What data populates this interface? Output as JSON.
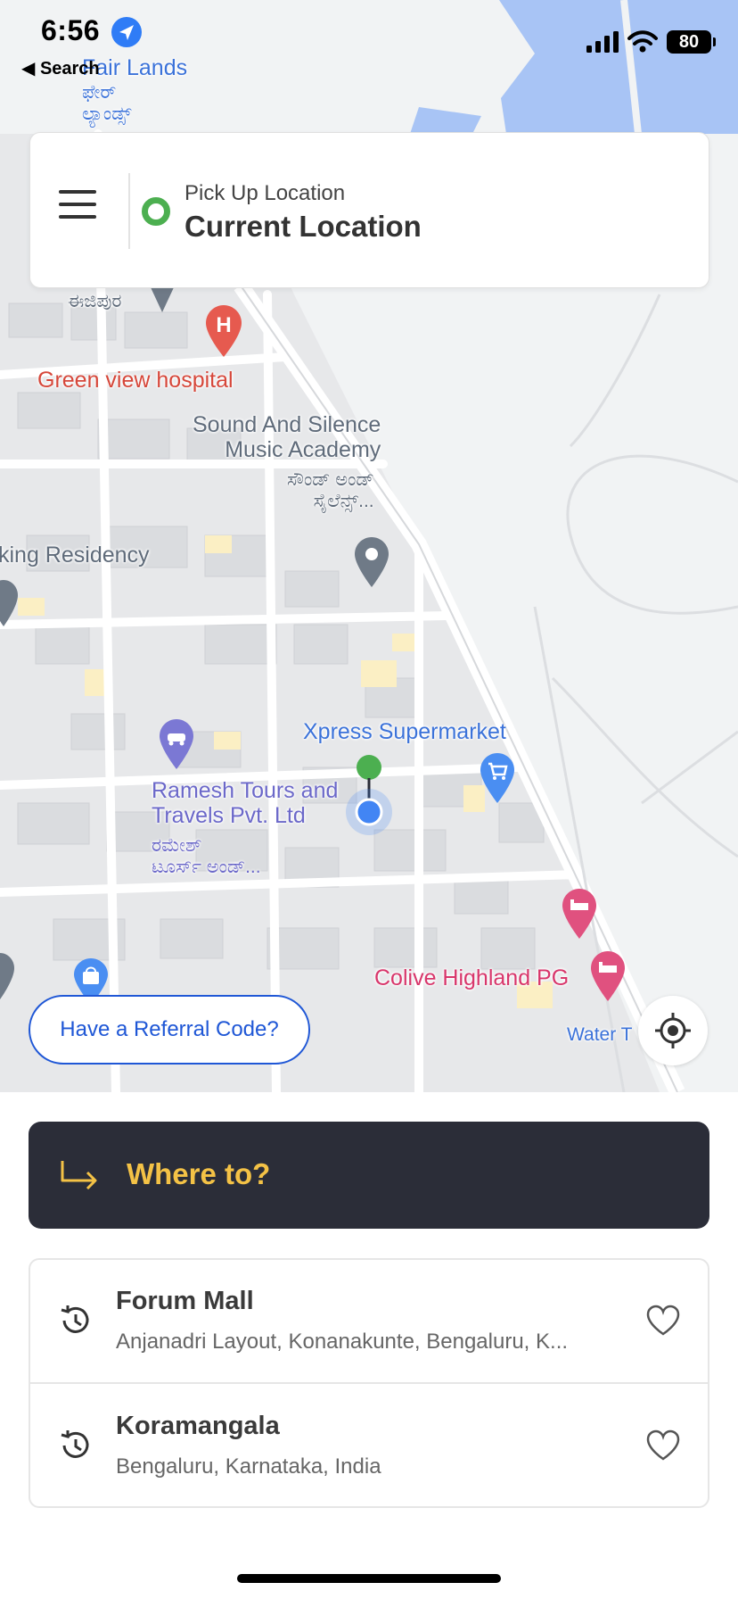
{
  "status_bar": {
    "time": "6:56",
    "back_label": "◀ Search",
    "battery": "80",
    "icons": [
      "location-arrow-icon",
      "signal-icon",
      "wifi-icon",
      "battery-icon"
    ]
  },
  "map": {
    "labels": {
      "fair_lands": "Fair Lands",
      "fair_lands_kn": "ಫೇರ್\nಲ್ಯಾಂಡ್ಸ್",
      "ejipura": "ಈಜಿಪುರ",
      "hospital": "Green view hospital",
      "sound_silence": "Sound And Silence\nMusic Academy",
      "sound_silence_kn": "ಸೌಂಡ್ ಅಂಡ್\nಸೈಲೆನ್ಸ್...",
      "residency": "king Residency",
      "xpress": "Xpress Supermarket",
      "ramesh": "Ramesh Tours and\nTravels Pvt. Ltd",
      "ramesh_kn": "ರಮೇಶ್\nಟೂರ್ಸ್ ಅಂಡ್...",
      "colive": "Colive Highland PG",
      "water": "Water T"
    }
  },
  "pickup": {
    "label": "Pick Up Location",
    "value": "Current Location"
  },
  "referral": {
    "label": "Have a Referral Code?"
  },
  "where_to": {
    "label": "Where to?"
  },
  "recent": [
    {
      "title": "Forum Mall",
      "subtitle": "Anjanadri Layout, Konanakunte, Bengaluru, K..."
    },
    {
      "title": "Koramangala",
      "subtitle": "Bengaluru, Karnataka, India"
    }
  ],
  "colors": {
    "accent_yellow": "#f4c246",
    "dark_panel": "#2b2d38",
    "referral_blue": "#1f57d6",
    "pickup_green": "#4caf50"
  }
}
